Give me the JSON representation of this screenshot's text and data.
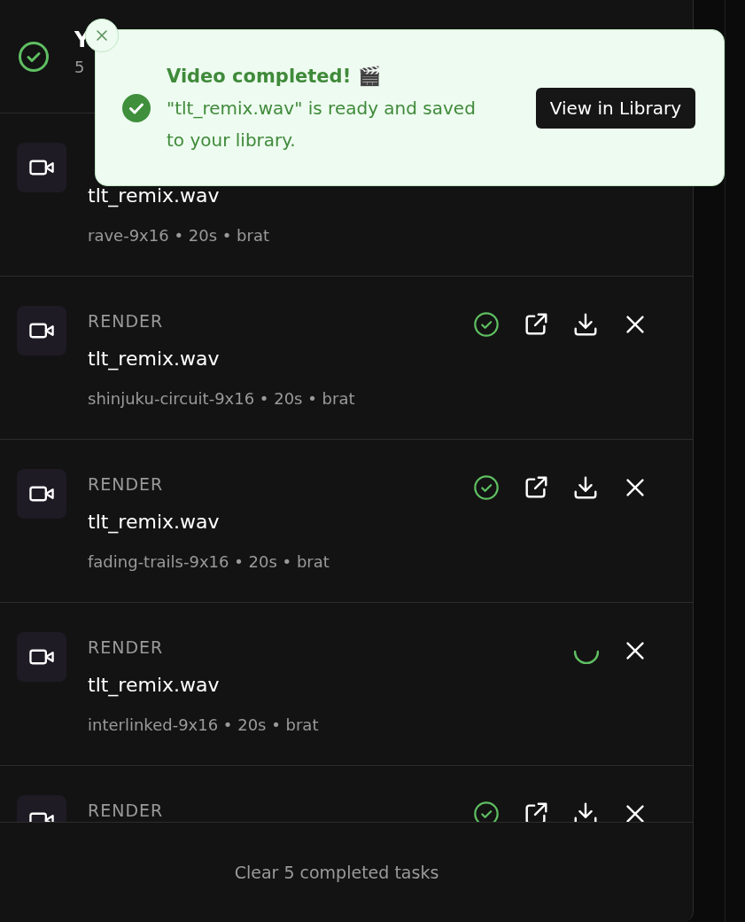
{
  "header": {
    "title": "Y",
    "subtitle": "5"
  },
  "tasks": [
    {
      "name": "tlt_remix.wav",
      "meta": "rave-9x16 • 20s • brat"
    },
    {
      "label": "RENDER",
      "name": "tlt_remix.wav",
      "meta": "shinjuku-circuit-9x16 • 20s • brat",
      "kind": "done"
    },
    {
      "label": "RENDER",
      "name": "tlt_remix.wav",
      "meta": "fading-trails-9x16 • 20s • brat",
      "kind": "done"
    },
    {
      "label": "RENDER",
      "name": "tlt_remix.wav",
      "meta": "interlinked-9x16 • 20s • brat",
      "kind": "running"
    },
    {
      "label": "RENDER",
      "kind": "done"
    }
  ],
  "footer": {
    "button": "Clear 5 completed tasks"
  },
  "toast": {
    "title": "Video completed! 🎬",
    "message": "\"tlt_remix.wav\" is ready and saved to your library.",
    "button": "View in Library"
  }
}
